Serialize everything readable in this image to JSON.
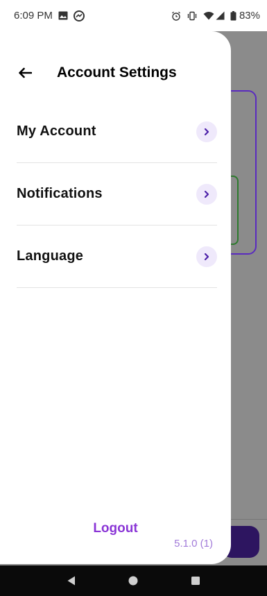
{
  "status_bar": {
    "time": "6:09 PM",
    "battery_text": "83%",
    "left_icons": [
      "image-icon",
      "messenger-icon"
    ],
    "right_icons": [
      "alarm-icon",
      "vibrate-icon",
      "wifi-icon",
      "signal-icon",
      "battery-icon"
    ]
  },
  "drawer": {
    "title": "Account Settings",
    "items": [
      {
        "label": "My Account"
      },
      {
        "label": "Notifications"
      },
      {
        "label": "Language"
      }
    ],
    "logout_label": "Logout",
    "version": "5.1.0 (1)"
  },
  "colors": {
    "accent": "#8a35d6",
    "chevron_bg": "#efe9fb",
    "backdrop": "#8b8b8b"
  }
}
